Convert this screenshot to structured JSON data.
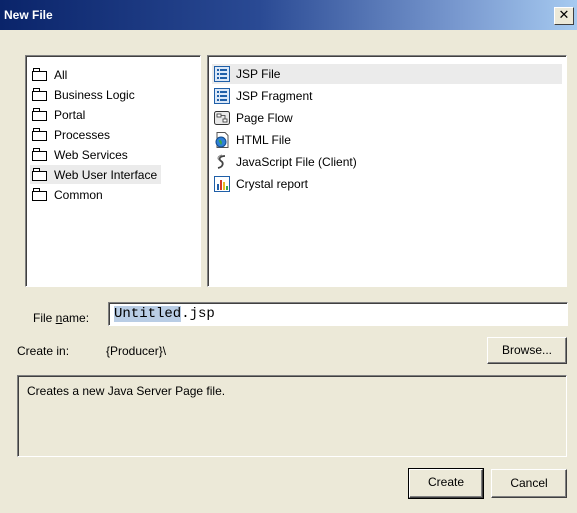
{
  "window": {
    "title": "New File",
    "close_glyph": "✕"
  },
  "categories": [
    {
      "label": "All",
      "icon": "folder-icon"
    },
    {
      "label": "Business Logic",
      "icon": "folder-icon"
    },
    {
      "label": "Portal",
      "icon": "folder-icon"
    },
    {
      "label": "Processes",
      "icon": "folder-icon"
    },
    {
      "label": "Web Services",
      "icon": "folder-icon"
    },
    {
      "label": "Web User Interface",
      "icon": "folder-icon",
      "selected": true
    },
    {
      "label": "Common",
      "icon": "folder-icon"
    }
  ],
  "templates": [
    {
      "label": "JSP File",
      "icon": "jsp-file-icon",
      "selected": true
    },
    {
      "label": "JSP Fragment",
      "icon": "jsp-fragment-icon"
    },
    {
      "label": "Page Flow",
      "icon": "page-flow-icon"
    },
    {
      "label": "HTML File",
      "icon": "html-file-icon"
    },
    {
      "label": "JavaScript File (Client)",
      "icon": "javascript-file-icon"
    },
    {
      "label": "Crystal report",
      "icon": "crystal-report-icon"
    }
  ],
  "file_name": {
    "label_prefix": "File ",
    "label_mnemonic": "n",
    "label_suffix": "ame:",
    "value_selected": "Untitled",
    "value_rest": ".jsp"
  },
  "create_in": {
    "label": "Create in:",
    "value": "{Producer}\\"
  },
  "buttons": {
    "browse": "Browse...",
    "create": "Create",
    "cancel": "Cancel"
  },
  "description": "Creates a new Java Server Page file.",
  "colors": {
    "title_gradient_start": "#0a246a",
    "title_gradient_end": "#a6caf0",
    "dialog_bg": "#ece9d8",
    "selection_bg": "#b9cde5"
  }
}
